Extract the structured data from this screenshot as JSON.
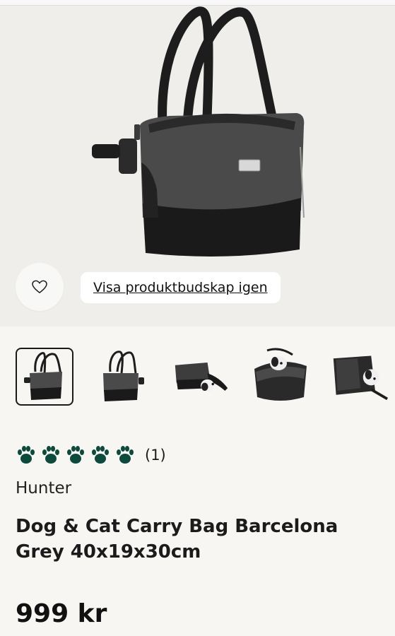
{
  "hero": {
    "image_icon": "tote-bag-product-image"
  },
  "favorite": {
    "icon": "heart-icon"
  },
  "message_pill": {
    "label": "Visa produktbudskap igen"
  },
  "thumbnails": [
    {
      "icon": "bag-front-thumb"
    },
    {
      "icon": "bag-side-thumb"
    },
    {
      "icon": "bag-dog-lying-thumb"
    },
    {
      "icon": "bag-dog-inside-thumb"
    },
    {
      "icon": "bag-dog-open-thumb"
    }
  ],
  "rating": {
    "count_label": "(1)",
    "paws": 5,
    "color": "#0c4a3c"
  },
  "product": {
    "brand": "Hunter",
    "title": "Dog & Cat Carry Bag Barcelona Grey 40x19x30cm",
    "price": "999 kr"
  }
}
